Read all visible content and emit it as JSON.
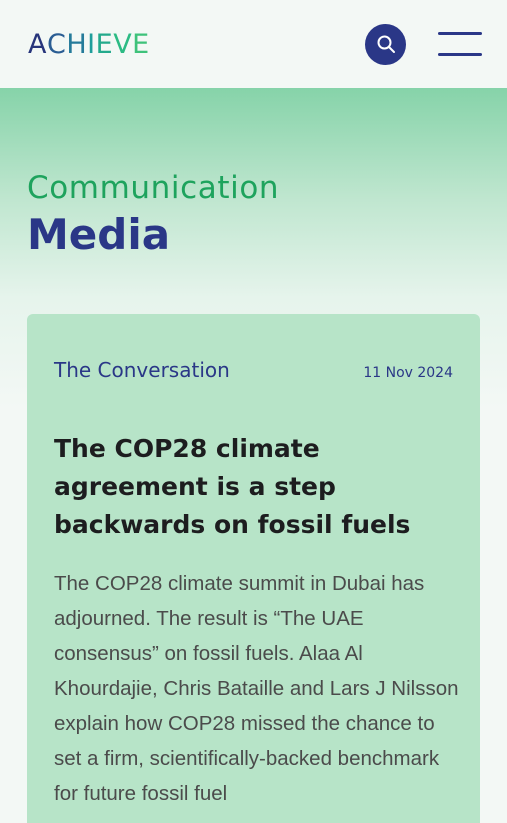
{
  "header": {
    "logo_text": "ACHIEVE",
    "search_icon": "search-icon",
    "menu_icon": "hamburger-menu-icon"
  },
  "hero": {
    "eyebrow": "Communication",
    "title": "Media"
  },
  "article": {
    "source": "The Conversation",
    "date": "11 Nov 2024",
    "title": "The COP28 climate agreement is a step backwards on fossil fuels",
    "summary": "The COP28 climate summit in Dubai has adjourned. The result is “The UAE consensus” on fossil fuels. Alaa Al Khourdajie, Chris Bataille and Lars J Nilsson explain how COP28 missed the chance to set a firm, scientifically-backed benchmark for future fossil fuel"
  },
  "colors": {
    "brand_navy": "#2a3787",
    "brand_green": "#1ea35d",
    "card_bg": "#b7e4c8",
    "page_bg": "#f3f8f5"
  }
}
